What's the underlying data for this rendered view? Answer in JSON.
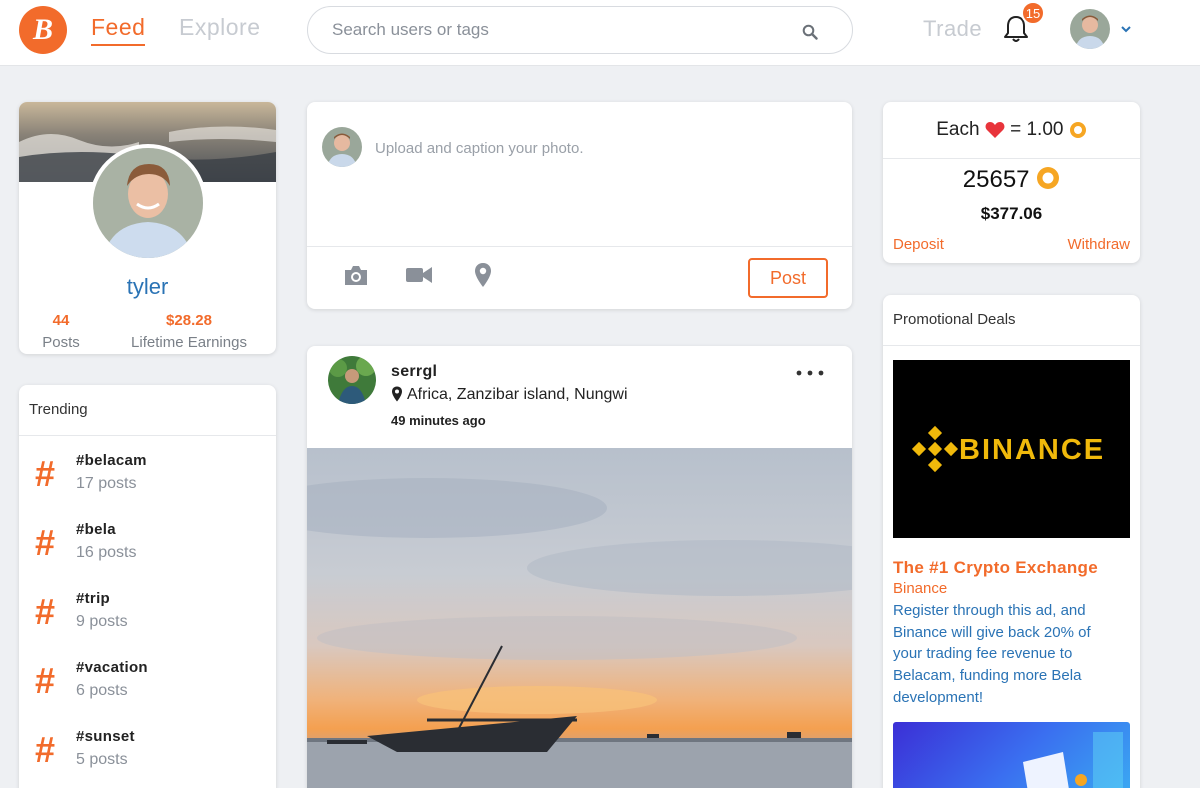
{
  "header": {
    "logo_letter": "B",
    "nav_feed": "Feed",
    "nav_explore": "Explore",
    "search_placeholder": "Search users or tags",
    "nav_trade": "Trade",
    "notification_count": "15"
  },
  "profile": {
    "username": "tyler",
    "posts_count": "44",
    "posts_label": "Posts",
    "earnings": "$28.28",
    "earnings_label": "Lifetime Earnings"
  },
  "trending": {
    "title": "Trending",
    "items": [
      {
        "tag": "#belacam",
        "count": "17 posts"
      },
      {
        "tag": "#bela",
        "count": "16 posts"
      },
      {
        "tag": "#trip",
        "count": "9 posts"
      },
      {
        "tag": "#vacation",
        "count": "6 posts"
      },
      {
        "tag": "#sunset",
        "count": "5 posts"
      }
    ]
  },
  "composer": {
    "placeholder": "Upload and caption your photo.",
    "post_label": "Post"
  },
  "post": {
    "user": "serrgl",
    "location": "Africa, Zanzibar island, Nungwi",
    "time": "49 minutes ago"
  },
  "balance": {
    "each_prefix": "Each",
    "each_suffix": "= 1.00",
    "amount": "25657",
    "usd": "$377.06",
    "deposit": "Deposit",
    "withdraw": "Withdraw"
  },
  "promo": {
    "title": "Promotional Deals",
    "ad_logo_text": "BINANCE",
    "ad_title": "The #1 Crypto Exchange",
    "ad_brand": "Binance",
    "ad_desc": "Register through this ad, and Binance will give back 20% of your trading fee revenue to Belacam, funding more Bela development!"
  },
  "colors": {
    "accent": "#f26b2b",
    "link": "#2a73b5",
    "heart": "#e8343b"
  },
  "icons": {
    "search": "search-icon",
    "bell": "bell-icon",
    "camera": "camera-icon",
    "video": "video-icon",
    "location": "location-pin-icon",
    "more": "more-dots-icon",
    "heart": "heart-icon",
    "coin": "bela-coin-icon"
  }
}
